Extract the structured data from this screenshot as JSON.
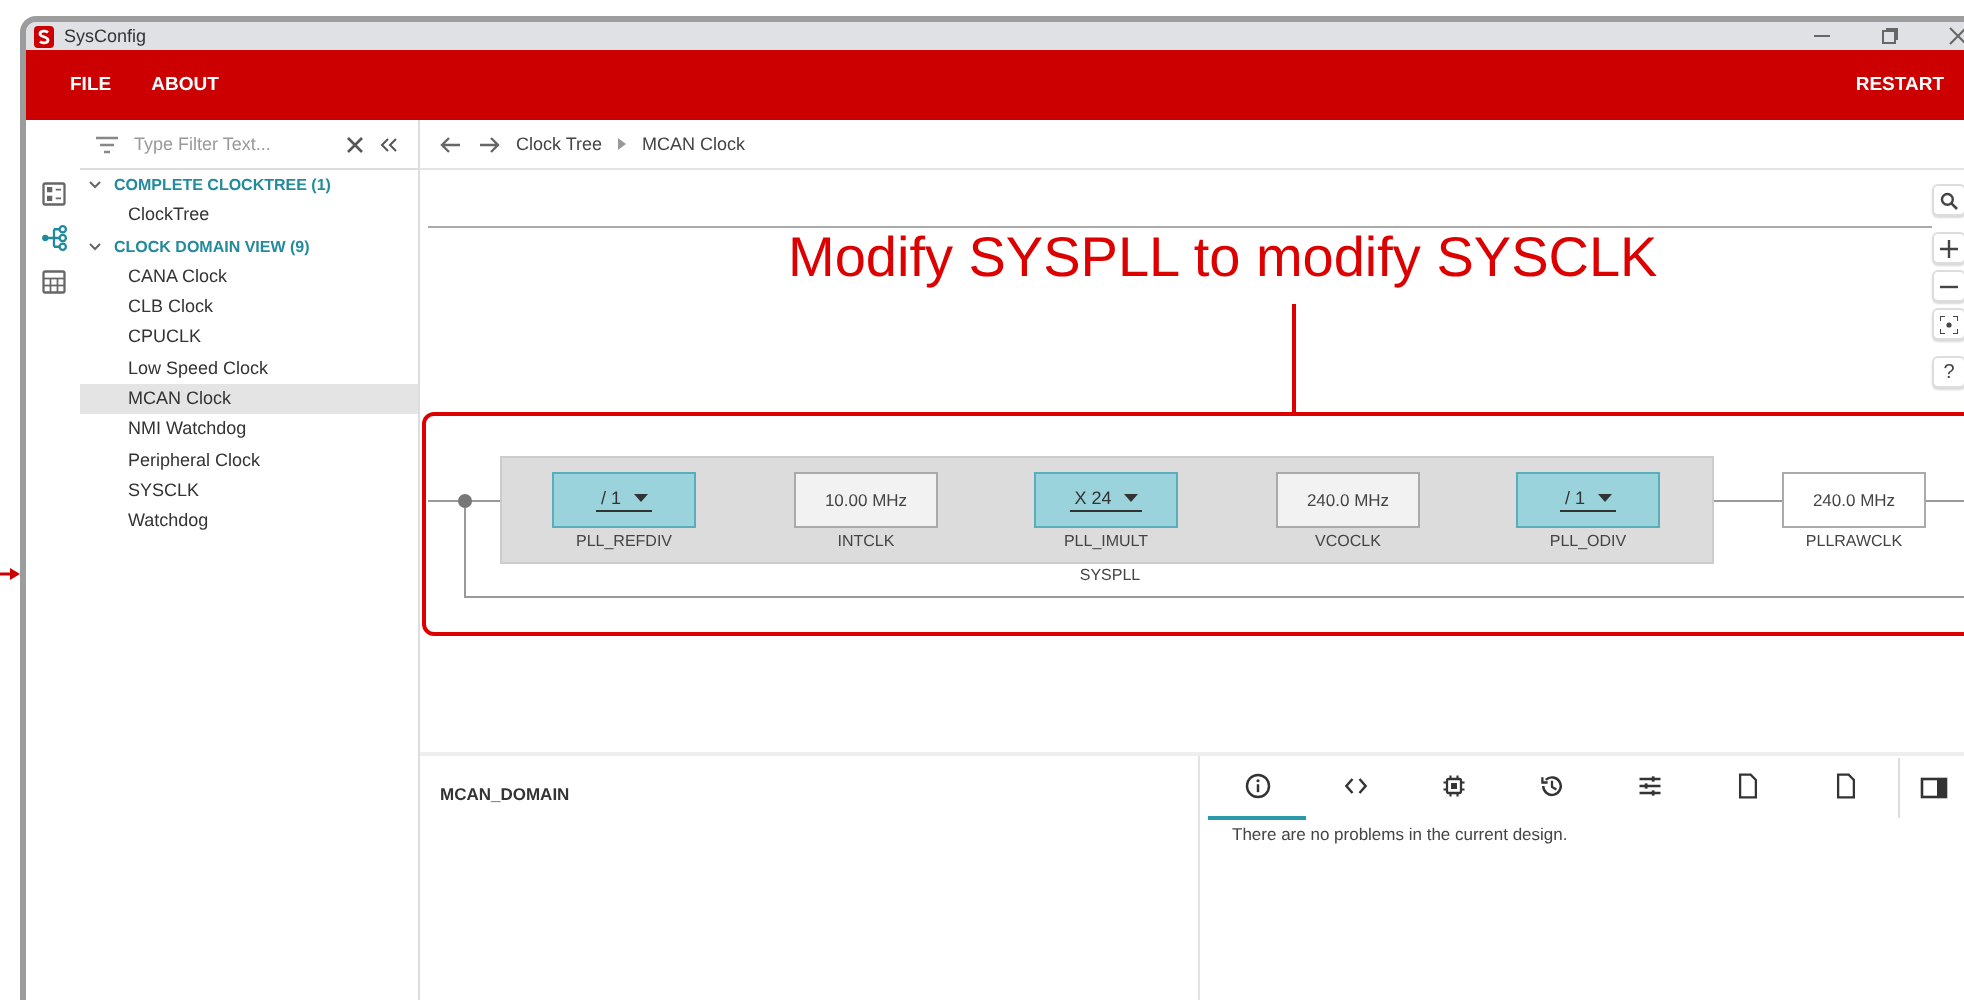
{
  "window": {
    "title": "SysConfig"
  },
  "menu": [
    "FILE",
    "ABOUT"
  ],
  "restart": "RESTART",
  "rail": [
    {
      "selected": false
    },
    {
      "selected": true
    },
    {
      "selected": false
    }
  ],
  "sidebar": {
    "filter": {
      "placeholder": "Type Filter Text..."
    },
    "sections": [
      {
        "label": "COMPLETE CLOCKTREE (1)",
        "expanded": true,
        "children": [
          {
            "label": "ClockTree",
            "selected": false
          }
        ]
      },
      {
        "label": "CLOCK DOMAIN VIEW (9)",
        "expanded": true,
        "children": [
          {
            "label": "CANA Clock",
            "selected": false
          },
          {
            "label": "CLB Clock",
            "selected": false
          },
          {
            "label": "CPUCLK",
            "selected": false
          },
          {
            "label": "Low Speed Clock",
            "selected": false
          },
          {
            "label": "MCAN Clock",
            "selected": true
          },
          {
            "label": "NMI Watchdog",
            "selected": false
          },
          {
            "label": "Peripheral Clock",
            "selected": false
          },
          {
            "label": "SYSCLK",
            "selected": false
          },
          {
            "label": "Watchdog",
            "selected": false
          }
        ]
      }
    ]
  },
  "breadcrumb": [
    "Clock Tree",
    "MCAN Clock"
  ],
  "annotation": "Modify SYSPLL to modify SYSCLK",
  "diagram": {
    "group": "SYSPLL",
    "nodes": [
      {
        "kind": "select",
        "value": "/ 1",
        "label": "PLL_REFDIV"
      },
      {
        "kind": "value",
        "value": "10.00 MHz",
        "label": "INTCLK"
      },
      {
        "kind": "select",
        "value": "X 24",
        "label": "PLL_IMULT"
      },
      {
        "kind": "value",
        "value": "240.0 MHz",
        "label": "VCOCLK"
      },
      {
        "kind": "select",
        "value": "/ 1",
        "label": "PLL_ODIV"
      },
      {
        "kind": "output",
        "value": "240.0 MHz",
        "label": "PLLRAWCLK"
      }
    ]
  },
  "tools": [
    "?"
  ],
  "bottom": {
    "title": "MCAN_DOMAIN",
    "tabs": [
      {
        "selected": true
      },
      {
        "selected": false
      },
      {
        "selected": false
      },
      {
        "selected": false
      },
      {
        "selected": false
      },
      {
        "selected": false
      },
      {
        "selected": false
      }
    ],
    "message": "There are no problems in the current design."
  }
}
